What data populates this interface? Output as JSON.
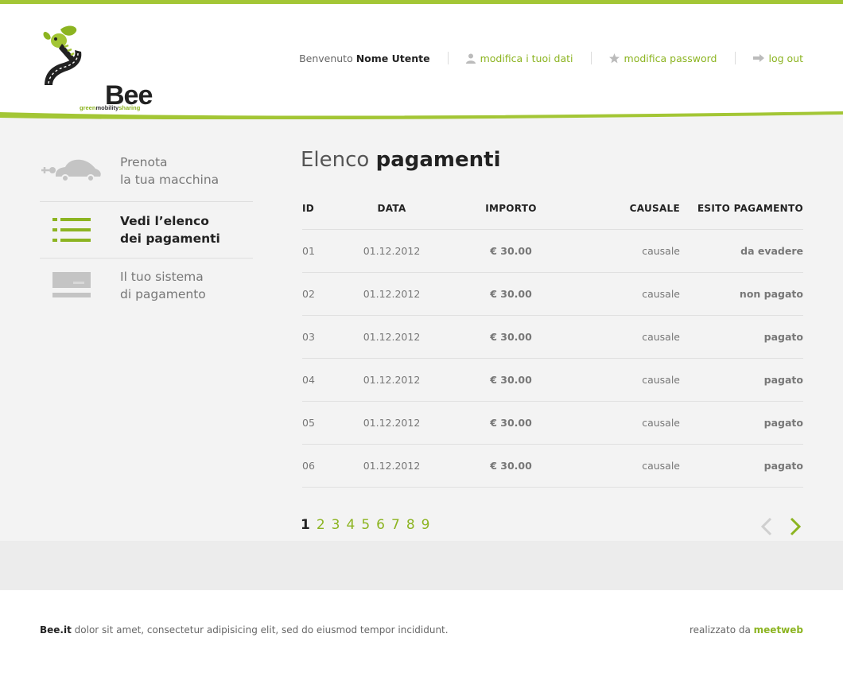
{
  "brand": {
    "logo_text": "Bee",
    "tagline_part1": "green",
    "tagline_part2": "mobility",
    "tagline_part3": "sharing",
    "accent_color": "#8cb421",
    "icon": "bee-road-logo"
  },
  "header": {
    "welcome_prefix": "Benvenuto",
    "user_name": "Nome Utente",
    "links": [
      {
        "label": "modifica i tuoi dati",
        "icon": "user-icon"
      },
      {
        "label": "modifica password",
        "icon": "star-icon"
      },
      {
        "label": "log out",
        "icon": "logout-arrow-icon"
      }
    ]
  },
  "sidebar": {
    "items": [
      {
        "line1": "Prenota",
        "line2": "la tua macchina",
        "icon": "car-icon",
        "active": false
      },
      {
        "line1": "Vedi l’elenco",
        "line2": "dei pagamenti",
        "icon": "list-icon",
        "active": true
      },
      {
        "line1": "Il tuo sistema",
        "line2": "di pagamento",
        "icon": "credit-card-icon",
        "active": false
      }
    ]
  },
  "main": {
    "title_light": "Elenco",
    "title_bold": "pagamenti",
    "table": {
      "columns": [
        "ID",
        "DATA",
        "IMPORTO",
        "CAUSALE",
        "ESITO PAGAMENTO"
      ],
      "rows": [
        {
          "id": "01",
          "data": "01.12.2012",
          "importo": "€ 30.00",
          "causale": "causale",
          "esito": "da evadere",
          "status": "evadere"
        },
        {
          "id": "02",
          "data": "01.12.2012",
          "importo": "€ 30.00",
          "causale": "causale",
          "esito": "non pagato",
          "status": "nonpagato"
        },
        {
          "id": "03",
          "data": "01.12.2012",
          "importo": "€ 30.00",
          "causale": "causale",
          "esito": "pagato",
          "status": "pagato"
        },
        {
          "id": "04",
          "data": "01.12.2012",
          "importo": "€ 30.00",
          "causale": "causale",
          "esito": "pagato",
          "status": "pagato"
        },
        {
          "id": "05",
          "data": "01.12.2012",
          "importo": "€ 30.00",
          "causale": "causale",
          "esito": "pagato",
          "status": "pagato"
        },
        {
          "id": "06",
          "data": "01.12.2012",
          "importo": "€ 30.00",
          "causale": "causale",
          "esito": "pagato",
          "status": "pagato"
        }
      ]
    },
    "pagination": {
      "pages": [
        "1",
        "2",
        "3",
        "4",
        "5",
        "6",
        "7",
        "8",
        "9"
      ],
      "current": "1",
      "prev_icon": "chevron-left-icon",
      "next_icon": "chevron-right-icon"
    }
  },
  "status_colors": {
    "evadere": "#222222",
    "nonpagato": "#8b1c24",
    "pagato": "#8cb421"
  },
  "footer": {
    "brand": "Bee.it",
    "text": "dolor sit amet, consectetur adipisicing elit, sed do eiusmod tempor incididunt.",
    "credit_prefix": "realizzato da",
    "credit_name": "meetweb"
  }
}
